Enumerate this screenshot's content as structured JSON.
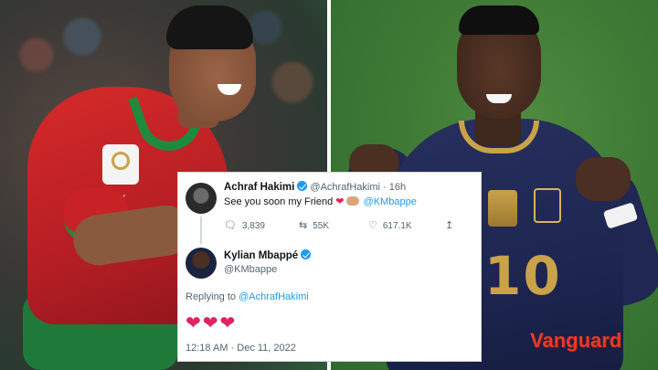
{
  "tweet": {
    "author_name": "Achraf Hakimi",
    "author_handle": "@AchrafHakimi",
    "separator": "·",
    "time_ago": "16h",
    "text": "See you soon my Friend",
    "mention": "@KMbappe",
    "stats": {
      "replies": "3,839",
      "retweets": "55K",
      "likes": "617.1K"
    }
  },
  "reply": {
    "author_name": "Kylian Mbappé",
    "author_handle": "@KMbappe",
    "replying_prefix": "Replying to",
    "replying_to": "@AchrafHakimi",
    "hearts": "❤❤❤",
    "timestamp": "12:18 AM · Dec 11, 2022"
  },
  "overlay": {
    "jersey_number": "10",
    "watermark": "Vanguard"
  },
  "colors": {
    "link_blue": "#1d9bf0",
    "heart_red": "#e0245e",
    "watermark_red": "#e53b2b",
    "morocco_red": "#c82226",
    "france_navy": "#1d2550"
  },
  "icons": [
    "verified-badge-icon",
    "reply-icon",
    "retweet-icon",
    "like-icon",
    "share-icon",
    "heart-icon",
    "handshake-icon"
  ]
}
